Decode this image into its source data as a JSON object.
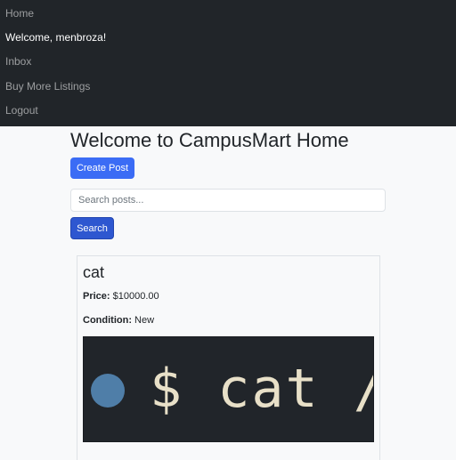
{
  "navbar": {
    "items": [
      {
        "label": "Home"
      },
      {
        "label": "Welcome, menbroza!"
      },
      {
        "label": "Inbox"
      },
      {
        "label": "Buy More Listings"
      },
      {
        "label": "Logout"
      }
    ]
  },
  "main": {
    "title": "Welcome to CampusMart Home",
    "create_post_label": "Create Post",
    "search": {
      "placeholder": "Search posts...",
      "value": "",
      "button_label": "Search"
    },
    "posts": [
      {
        "title": "cat",
        "price_label": "Price:",
        "price": "$10000.00",
        "condition_label": "Condition:",
        "condition": "New",
        "image_text": "$ cat /"
      }
    ]
  },
  "colors": {
    "navbar_bg": "#212529",
    "page_bg": "#f8f9fa",
    "primary": "#3b6cf5",
    "search_button": "#2e57d0"
  }
}
